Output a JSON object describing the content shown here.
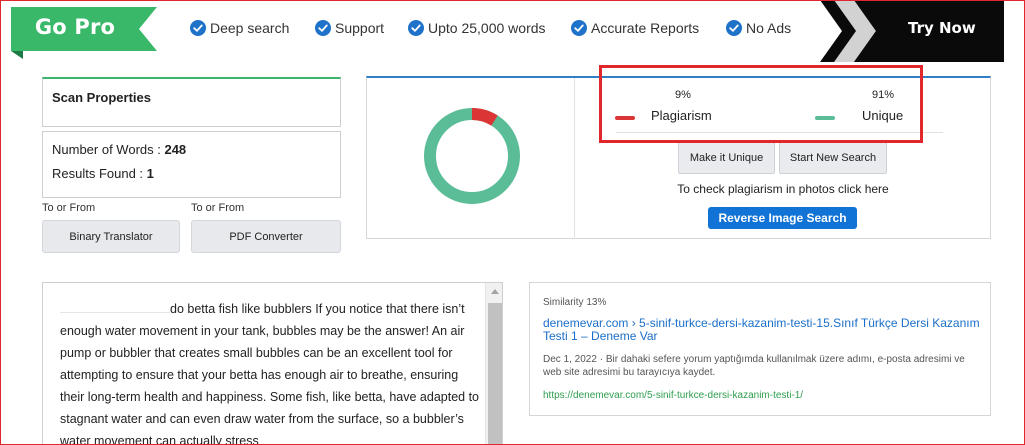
{
  "promo": {
    "go_pro": "Go Pro",
    "features": [
      "Deep search",
      "Support",
      "Upto 25,000 words",
      "Accurate Reports",
      "No Ads"
    ],
    "try_now": "Try Now",
    "colors": {
      "go_pro_green": "#39b86a",
      "check_blue": "#1f72c9",
      "try_now_black": "#0a0a0a"
    }
  },
  "scan": {
    "title": "Scan Properties",
    "words_label": "Number of Words : ",
    "words_value": "248",
    "results_label": "Results Found : ",
    "results_value": "1"
  },
  "tools": [
    {
      "to_from": "To or From",
      "label": "Binary Translator"
    },
    {
      "to_from": "To or From",
      "label": "PDF Converter"
    }
  ],
  "result": {
    "plagiarism_pct": "9%",
    "plagiarism_label": "Plagiarism",
    "unique_pct": "91%",
    "unique_label": "Unique",
    "plagiarism_fraction": 0.09,
    "colors": {
      "plagiarism": "#dc3535",
      "unique": "#5bbd97"
    },
    "make_unique": "Make it Unique",
    "start_new": "Start New Search",
    "photo_note": "To check plagiarism in photos click here",
    "reverse_search": "Reverse Image Search"
  },
  "text": {
    "content": "do betta fish like bubblers If you notice that there isn’t enough water movement in your tank, bubbles may be the answer! An air pump or bubbler that creates small bubbles can be an excellent tool for attempting to ensure that your betta has enough air to breathe, ensuring their long-term health and happiness. Some fish, like betta, have adapted to stagnant water and can even draw water from the surface, so a bubbler’s water movement can actually stress"
  },
  "similarity": {
    "title": "Similarity 13%",
    "link": "denemevar.com › 5-sinif-turkce-dersi-kazanim-testi-15.Sınıf Türkçe Dersi Kazanım Testi 1 – Deneme Var",
    "description": "Dec 1, 2022 · Bir dahaki sefere yorum yaptığımda kullanılmak üzere adımı, e-posta adresimi ve web site adresimi bu tarayıcıya kaydet.",
    "url": "https://denemevar.com/5-sinif-turkce-dersi-kazanim-testi-1/"
  }
}
